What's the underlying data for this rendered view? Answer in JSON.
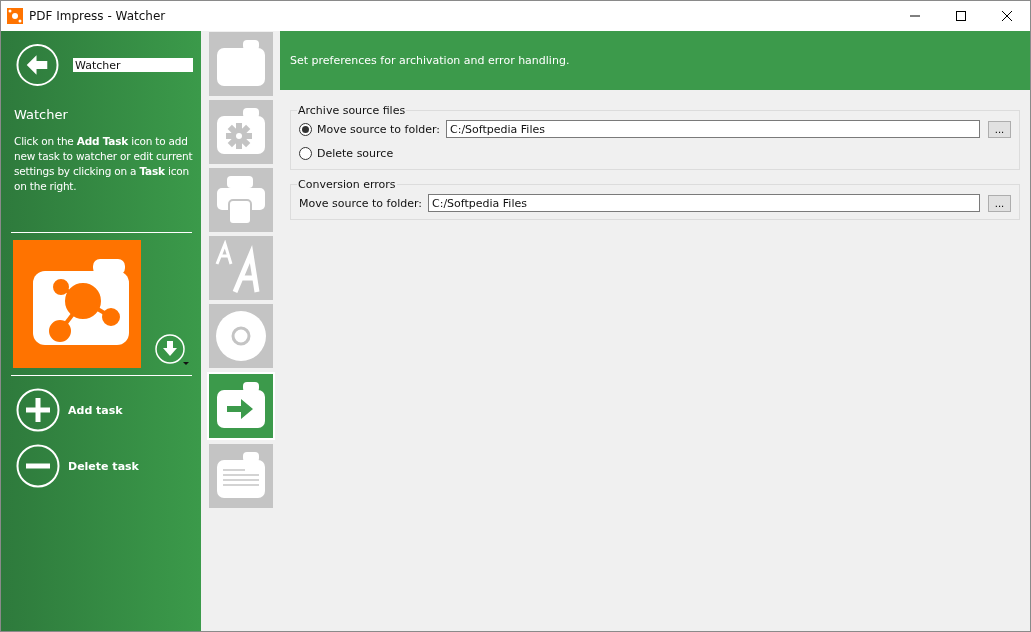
{
  "window": {
    "title": "PDF Impress - Watcher"
  },
  "sidebar": {
    "name_field": {
      "value": "Watcher"
    },
    "heading": "Watcher",
    "description": "Click on the **Add Task** icon to add new task to watcher or edit current settings by clicking on a **Task** icon on the right.",
    "actions": [
      {
        "kind": "add",
        "label": "Add task"
      },
      {
        "kind": "delete",
        "label": "Delete task"
      }
    ]
  },
  "tabs": [
    {
      "kind": "folder",
      "selected": false
    },
    {
      "kind": "settings",
      "selected": false
    },
    {
      "kind": "printer",
      "selected": false
    },
    {
      "kind": "fonts",
      "selected": false
    },
    {
      "kind": "disc",
      "selected": false
    },
    {
      "kind": "move",
      "selected": true
    },
    {
      "kind": "document",
      "selected": false
    }
  ],
  "header": {
    "text": "Set preferences for archivation and error handling."
  },
  "groups": [
    {
      "title": "Archive source files",
      "rows": [
        {
          "kind": "radio",
          "label": "Move source to folder:",
          "selected": true,
          "value": "C:/Softpedia Files",
          "browse": "..."
        },
        {
          "kind": "radio",
          "label": "Delete source",
          "selected": false
        }
      ]
    },
    {
      "title": "Conversion errors",
      "rows": [
        {
          "kind": "field",
          "label": "Move source to folder:",
          "value": "C:/Softpedia Files",
          "browse": "..."
        }
      ]
    }
  ]
}
